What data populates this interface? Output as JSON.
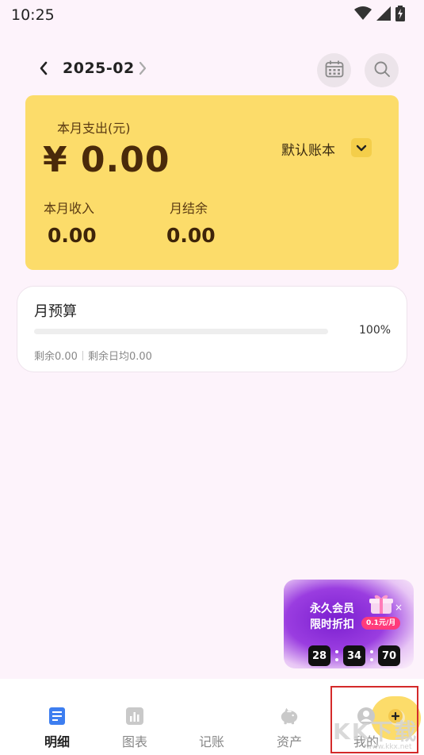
{
  "status_bar": {
    "time": "10:25",
    "icons": [
      "wifi-icon",
      "cellular-signal-icon",
      "battery-charging-icon"
    ]
  },
  "header": {
    "month": "2025-02",
    "icons": [
      "chevron-left-icon",
      "chevron-right-icon",
      "calendar-icon",
      "search-icon"
    ]
  },
  "summary": {
    "expense_label": "本月支出(元)",
    "expense_amount": "¥ 0.00",
    "account_book": "默认账本",
    "income_label": "本月收入",
    "income_value": "0.00",
    "balance_label": "月结余",
    "balance_value": "0.00"
  },
  "budget": {
    "title": "月预算",
    "percent": "100%",
    "progress_fraction": 0,
    "remaining": "剩余0.00",
    "daily_remaining": "剩余日均0.00"
  },
  "promo": {
    "title": "永久会员",
    "subtitle": "限时折扣",
    "price": "0.1元/月",
    "close": "×",
    "timer": [
      "28",
      "34",
      "70"
    ]
  },
  "tabs": [
    {
      "label": "明细",
      "icon": "detail-list-icon",
      "active": true
    },
    {
      "label": "图表",
      "icon": "chart-icon",
      "active": false
    },
    {
      "label": "记账",
      "icon": "add-record-icon",
      "active": false
    },
    {
      "label": "资产",
      "icon": "piggy-bank-icon",
      "active": false
    },
    {
      "label": "我的",
      "icon": "profile-icon",
      "active": false
    }
  ],
  "watermark": {
    "text": "KK下载",
    "url": "www.kkx.net"
  },
  "colors": {
    "background": "#fdf3fb",
    "accent_yellow": "#fcdc6a",
    "amount_brown": "#4a2a0a",
    "active_tab_blue": "#3d7ef0",
    "highlight_red": "#d42a2a"
  }
}
